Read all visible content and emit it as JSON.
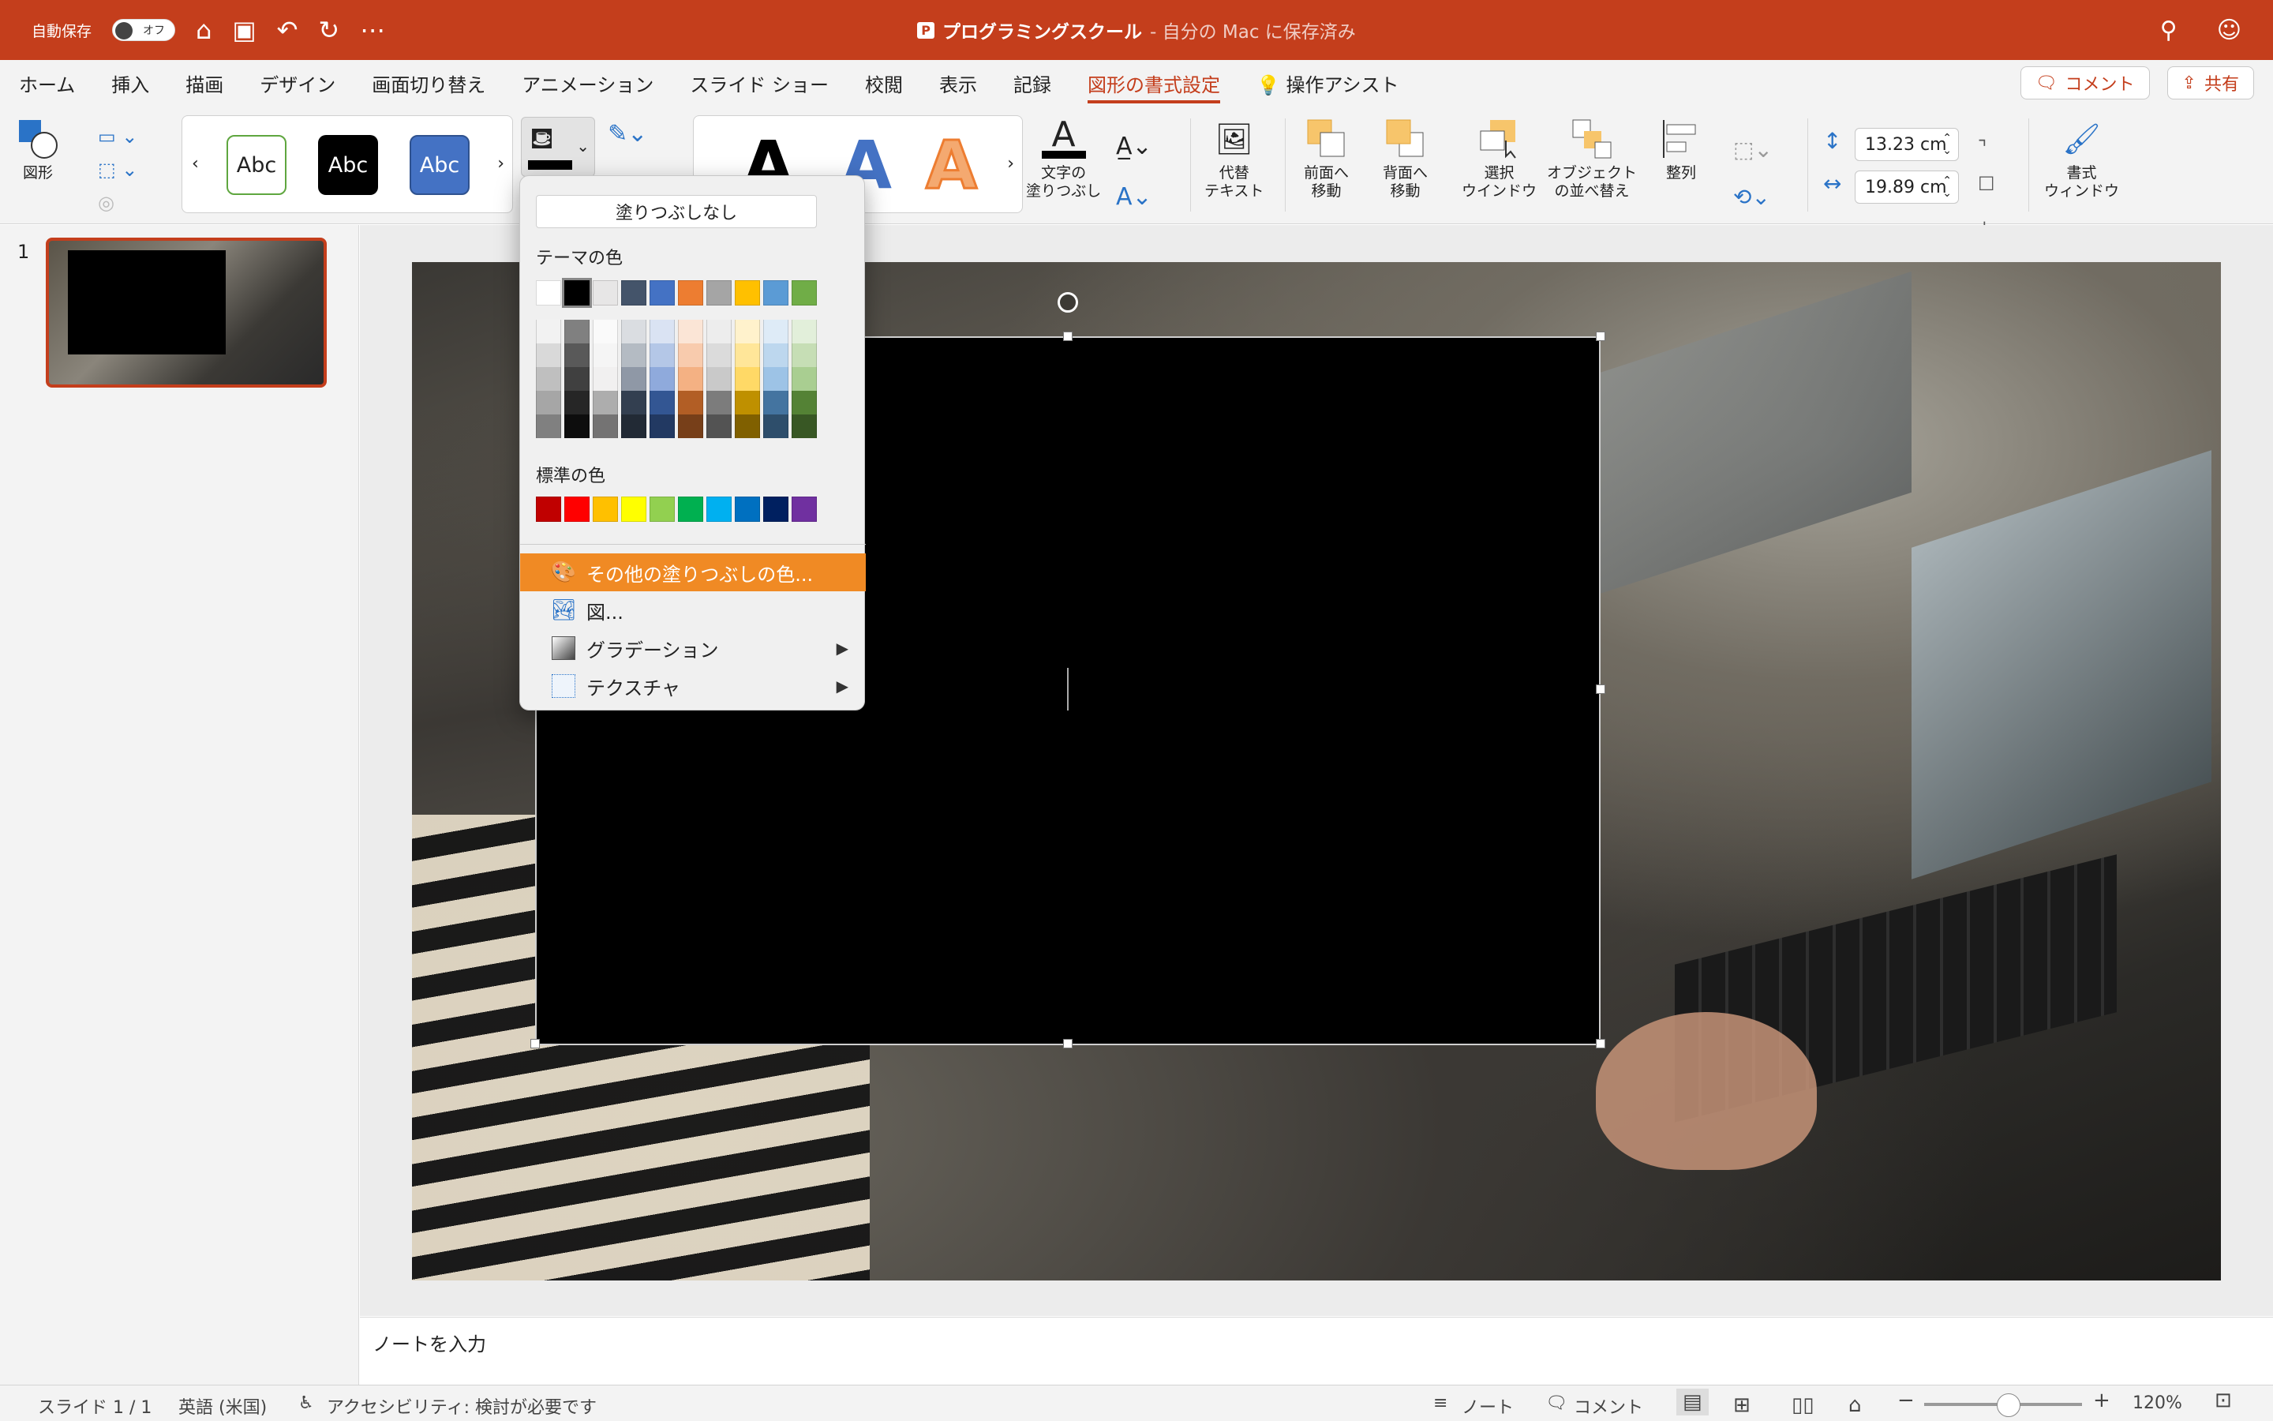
{
  "titlebar": {
    "autosave": "自動保存",
    "toggle": "オフ",
    "doc_title": "プログラミングスクール",
    "doc_status": "- 自分の Mac に保存済み"
  },
  "menu": {
    "tabs": [
      "ホーム",
      "挿入",
      "描画",
      "デザイン",
      "画面切り替え",
      "アニメーション",
      "スライド ショー",
      "校閲",
      "表示",
      "記録",
      "図形の書式設定"
    ],
    "assist": "操作アシスト",
    "comment": "コメント",
    "share": "共有"
  },
  "ribbon": {
    "shapes": "図形",
    "style1": "Abc",
    "style2": "Abc",
    "style3": "Abc",
    "text_fill_1": "文字の",
    "text_fill_2": "塗りつぶし",
    "alt_text_1": "代替",
    "alt_text_2": "テキスト",
    "forward_1": "前面へ",
    "forward_2": "移動",
    "backward_1": "背面へ",
    "backward_2": "移動",
    "select_1": "選択",
    "select_2": "ウインドウ",
    "reorder_1": "オブジェクト",
    "reorder_2": "の並べ替え",
    "arrange": "整列",
    "height": "13.23 cm",
    "width": "19.89 cm",
    "format_1": "書式",
    "format_2": "ウィンドウ"
  },
  "thumbnails": {
    "num": "1"
  },
  "notes": {
    "placeholder": "ノートを入力"
  },
  "status": {
    "slide": "スライド 1 / 1",
    "lang": "英語 (米国)",
    "access": "アクセシビリティ: 検討が必要です",
    "notes": "ノート",
    "comments": "コメント",
    "zoom": "120%"
  },
  "fill_menu": {
    "no_fill": "塗りつぶしなし",
    "theme_label": "テーマの色",
    "std_label": "標準の色",
    "more": "その他の塗りつぶしの色...",
    "picture": "図...",
    "gradient": "グラデーション",
    "texture": "テクスチャ",
    "theme_colors": [
      "#ffffff",
      "#000000",
      "#e7e6e6",
      "#44546a",
      "#4472c4",
      "#ed7d31",
      "#a5a5a5",
      "#ffc000",
      "#5b9bd5",
      "#70ad47"
    ],
    "std_colors": [
      "#c00000",
      "#ff0000",
      "#ffc000",
      "#ffff00",
      "#92d050",
      "#00b050",
      "#00b0f0",
      "#0070c0",
      "#002060",
      "#7030a0"
    ]
  },
  "colors": {
    "accent": "#c43e1c",
    "highlight": "#f08a24"
  }
}
